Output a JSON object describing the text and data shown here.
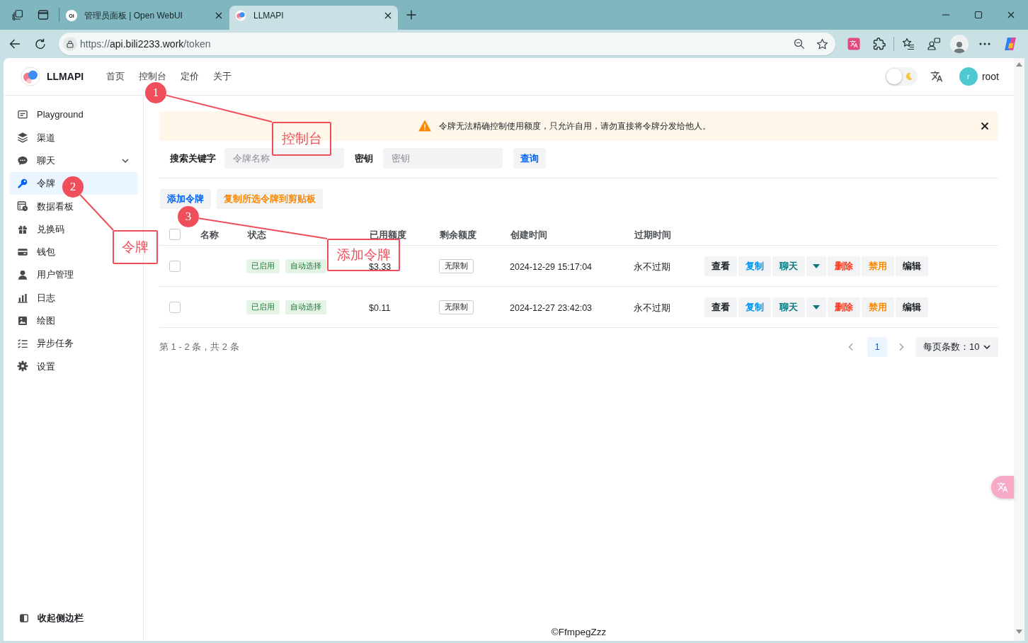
{
  "browser": {
    "tabs": [
      {
        "favicon_text": "OI",
        "title": "管理员面板 | Open WebUI",
        "selected": false
      },
      {
        "title": "LLMAPI",
        "selected": true
      }
    ],
    "address": {
      "scheme": "https://",
      "host": "api.bili2233.work",
      "path": "/token"
    }
  },
  "header": {
    "brand": "LLMAPI",
    "nav": [
      {
        "label": "首页",
        "selected": false
      },
      {
        "label": "控制台",
        "selected": false
      },
      {
        "label": "定价",
        "selected": false
      },
      {
        "label": "关于",
        "selected": false
      }
    ],
    "dark_mode": {
      "on": false
    },
    "user": {
      "initial": "r",
      "name": "root"
    }
  },
  "sidebar": {
    "items": [
      {
        "label": "Playground",
        "kind": "link",
        "selected": false
      },
      {
        "label": "渠道",
        "kind": "link",
        "selected": false
      },
      {
        "label": "聊天",
        "kind": "group",
        "expanded": false,
        "selected": false
      },
      {
        "label": "令牌",
        "kind": "link",
        "selected": true
      },
      {
        "label": "数据看板",
        "kind": "link",
        "selected": false
      },
      {
        "label": "兑换码",
        "kind": "link",
        "selected": false
      },
      {
        "label": "钱包",
        "kind": "link",
        "selected": false
      },
      {
        "label": "用户管理",
        "kind": "link",
        "selected": false
      },
      {
        "label": "日志",
        "kind": "link",
        "selected": false
      },
      {
        "label": "绘图",
        "kind": "link",
        "selected": false
      },
      {
        "label": "异步任务",
        "kind": "link",
        "selected": false
      },
      {
        "label": "设置",
        "kind": "link",
        "selected": false
      }
    ],
    "collapse": "收起侧边栏"
  },
  "notice": {
    "text": "令牌无法精确控制使用额度，只允许自用，请勿直接将令牌分发给他人。"
  },
  "search": {
    "fields": [
      {
        "label": "搜索关键字",
        "placeholder": "令牌名称"
      },
      {
        "label": "密钥",
        "placeholder": "密钥"
      }
    ],
    "button": "查询"
  },
  "actions": [
    {
      "label": "添加令牌",
      "kind": "primary"
    },
    {
      "label": "复制所选令牌到剪贴板",
      "kind": "warning"
    }
  ],
  "table": {
    "select_all": {
      "checked": false
    },
    "columns": [
      "名称",
      "状态",
      "已用额度",
      "剩余额度",
      "创建时间",
      "过期时间"
    ],
    "rows": [
      {
        "checked": false,
        "status_tags": [
          "已启用",
          "自动选择"
        ],
        "used": "$3.33",
        "remaining": "无限制",
        "created": "2024-12-29 15:17:04",
        "expires": "永不过期",
        "actions": [
          {
            "label": "查看",
            "kind": "default"
          },
          {
            "label": "复制",
            "kind": "secondary"
          },
          {
            "label": "聊天",
            "kind": "chat"
          },
          {
            "kind": "menu"
          },
          {
            "label": "删除",
            "kind": "danger"
          },
          {
            "label": "禁用",
            "kind": "warning"
          },
          {
            "label": "编辑",
            "kind": "default"
          }
        ]
      },
      {
        "checked": false,
        "status_tags": [
          "已启用",
          "自动选择"
        ],
        "used": "$0.11",
        "remaining": "无限制",
        "created": "2024-12-27 23:42:03",
        "expires": "永不过期",
        "actions": [
          {
            "label": "查看",
            "kind": "default"
          },
          {
            "label": "复制",
            "kind": "secondary"
          },
          {
            "label": "聊天",
            "kind": "chat"
          },
          {
            "kind": "menu"
          },
          {
            "label": "删除",
            "kind": "danger"
          },
          {
            "label": "禁用",
            "kind": "warning"
          },
          {
            "label": "编辑",
            "kind": "default"
          }
        ]
      }
    ]
  },
  "pagination": {
    "summary": "第 1 - 2 条，共 2 条",
    "pages": [
      {
        "label": "1",
        "selected": true
      }
    ],
    "page_size": "每页条数：10"
  },
  "footer": "©FfmpegZzz",
  "annotations": [
    {
      "number": "1",
      "label": "控制台"
    },
    {
      "number": "2",
      "label": "令牌"
    },
    {
      "number": "3",
      "label": "添加令牌"
    }
  ]
}
